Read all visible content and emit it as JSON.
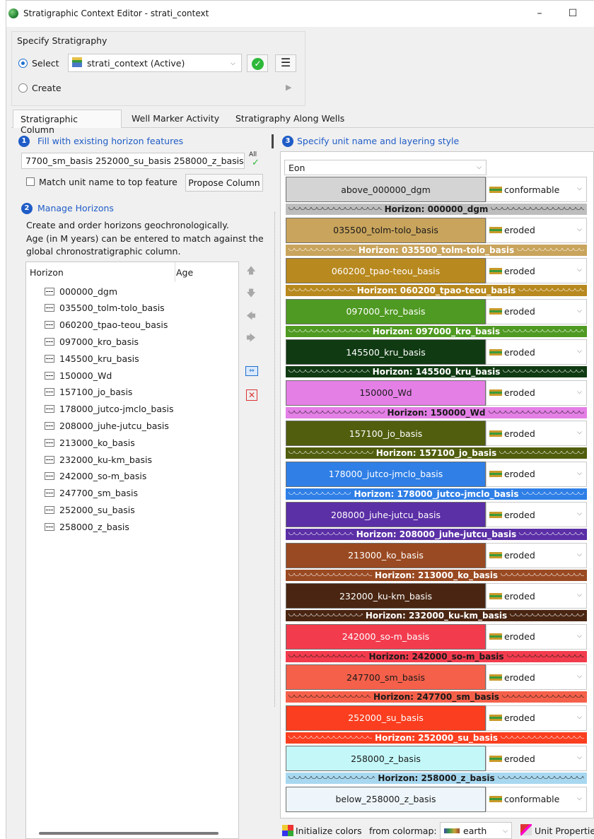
{
  "window": {
    "title": "Stratigraphic Context Editor - strati_context",
    "minimize": "–",
    "maximize": "☐"
  },
  "specify": {
    "group_title": "Specify Stratigraphy",
    "select_label": "Select",
    "select_value": "strati_context (Active)",
    "create_label": "Create"
  },
  "tabs": [
    "Stratigraphic Column",
    "Well Marker Activity",
    "Stratigraphy Along Wells"
  ],
  "fill": {
    "step": "1",
    "title": "Fill with existing horizon features",
    "combo_value": "7700_sm_basis 252000_su_basis 258000_z_basis",
    "all_label": "All",
    "match_label": "Match unit name to top feature",
    "propose_label": "Propose Column"
  },
  "manage": {
    "step": "2",
    "title": "Manage Horizons",
    "desc1": "Create and order horizons geochronologically.",
    "desc2": "Age (in M years) can be entered to match against the",
    "desc3": "global chronostratigraphic column.",
    "col_horizon": "Horizon",
    "col_age": "Age",
    "horizons": [
      "000000_dgm",
      "035500_tolm-tolo_basis",
      "060200_tpao-teou_basis",
      "097000_kro_basis",
      "145500_kru_basis",
      "150000_Wd",
      "157100_jo_basis",
      "178000_jutco-jmclo_basis",
      "208000_juhe-jutcu_basis",
      "213000_ko_basis",
      "232000_ku-km_basis",
      "242000_so-m_basis",
      "247700_sm_basis",
      "252000_su_basis",
      "258000_z_basis"
    ]
  },
  "specify_units": {
    "step": "3",
    "title": "Specify unit name and layering style",
    "level_value": "Eon",
    "units": [
      {
        "name": "above_000000_dgm",
        "style": "conformable",
        "color": "#d4d4d4",
        "text": "#1a1a1a"
      },
      {
        "name": "035500_tolm-tolo_basis",
        "style": "eroded",
        "color": "#c9a45c",
        "text": "#1a1a1a"
      },
      {
        "name": "060200_tpao-teou_basis",
        "style": "eroded",
        "color": "#b8891f",
        "text": "#ffffff"
      },
      {
        "name": "097000_kro_basis",
        "style": "eroded",
        "color": "#4f9a22",
        "text": "#ffffff"
      },
      {
        "name": "145500_kru_basis",
        "style": "eroded",
        "color": "#103a12",
        "text": "#ffffff"
      },
      {
        "name": "150000_Wd",
        "style": "eroded",
        "color": "#e47fe6",
        "text": "#1a1a1a"
      },
      {
        "name": "157100_jo_basis",
        "style": "eroded",
        "color": "#515e0e",
        "text": "#ffffff"
      },
      {
        "name": "178000_jutco-jmclo_basis",
        "style": "eroded",
        "color": "#2f7fe6",
        "text": "#ffffff"
      },
      {
        "name": "208000_juhe-jutcu_basis",
        "style": "eroded",
        "color": "#5b2fa6",
        "text": "#ffffff"
      },
      {
        "name": "213000_ko_basis",
        "style": "eroded",
        "color": "#9a4a22",
        "text": "#ffffff"
      },
      {
        "name": "232000_ku-km_basis",
        "style": "eroded",
        "color": "#4a2612",
        "text": "#ffffff"
      },
      {
        "name": "242000_so-m_basis",
        "style": "eroded",
        "color": "#f23c4e",
        "text": "#ffffff"
      },
      {
        "name": "247700_sm_basis",
        "style": "eroded",
        "color": "#f5604a",
        "text": "#1a1a1a"
      },
      {
        "name": "252000_su_basis",
        "style": "eroded",
        "color": "#fa3e1f",
        "text": "#ffffff"
      },
      {
        "name": "258000_z_basis",
        "style": "eroded",
        "color": "#c4f8f8",
        "text": "#1a1a1a"
      },
      {
        "name": "below_258000_z_basis",
        "style": "conformable",
        "color": "#eef6fc",
        "text": "#1a1a1a"
      }
    ],
    "horizon_labels": [
      "Horizon: 000000_dgm",
      "Horizon: 035500_tolm-tolo_basis",
      "Horizon: 060200_tpao-teou_basis",
      "Horizon: 097000_kro_basis",
      "Horizon: 145500_kru_basis",
      "Horizon: 150000_Wd",
      "Horizon: 157100_jo_basis",
      "Horizon: 178000_jutco-jmclo_basis",
      "Horizon: 208000_juhe-jutcu_basis",
      "Horizon: 213000_ko_basis",
      "Horizon: 232000_ku-km_basis",
      "Horizon: 242000_so-m_basis",
      "Horizon: 247700_sm_basis",
      "Horizon: 252000_su_basis",
      "Horizon: 258000_z_basis"
    ],
    "horizon_colors": [
      "#bdbdbd",
      "#c9a45c",
      "#b8891f",
      "#4f9a22",
      "#103a12",
      "#e47fe6",
      "#515e0e",
      "#2f7fe6",
      "#5b2fa6",
      "#9a4a22",
      "#4a2612",
      "#f23c4e",
      "#f5604a",
      "#fa3e1f",
      "#a8d8f0"
    ],
    "horizon_text_colors": [
      "#1a1a1a",
      "#ffffff",
      "#ffffff",
      "#ffffff",
      "#ffffff",
      "#1a1a1a",
      "#ffffff",
      "#ffffff",
      "#ffffff",
      "#ffffff",
      "#ffffff",
      "#1a1a1a",
      "#1a1a1a",
      "#ffffff",
      "#1a1a1a"
    ]
  },
  "bottom": {
    "init_label": "Initialize colors",
    "colormap_label": "from colormap:",
    "colormap_value": "earth",
    "unit_props_label": "Unit Propertie"
  }
}
